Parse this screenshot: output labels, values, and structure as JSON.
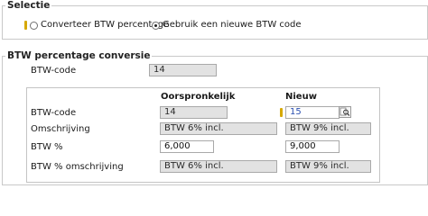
{
  "selectie": {
    "title": "Selectie",
    "options": [
      {
        "label": "Converteer BTW percentage",
        "selected": false
      },
      {
        "label": "Gebruik een nieuwe BTW code",
        "selected": true
      }
    ]
  },
  "conversie": {
    "title": "BTW percentage conversie",
    "btw_code_label": "BTW-code",
    "btw_code_value": "14",
    "columns": {
      "original": "Oorspronkelijk",
      "new": "Nieuw"
    },
    "rows": [
      {
        "label": "BTW-code",
        "original": "14",
        "new": "15"
      },
      {
        "label": "Omschrijving",
        "original": "BTW 6% incl.",
        "new": "BTW 9% incl."
      },
      {
        "label": "BTW %",
        "original": "6,000",
        "new": "9,000"
      },
      {
        "label": "BTW % omschrijving",
        "original": "BTW 6% incl.",
        "new": "BTW 9% incl."
      }
    ]
  },
  "colors": {
    "required_marker": "#d6a800",
    "readonly_bg": "#e2e2e2",
    "link_value": "#2a4fb0"
  },
  "icons": {
    "lookup": "search-document-icon"
  }
}
